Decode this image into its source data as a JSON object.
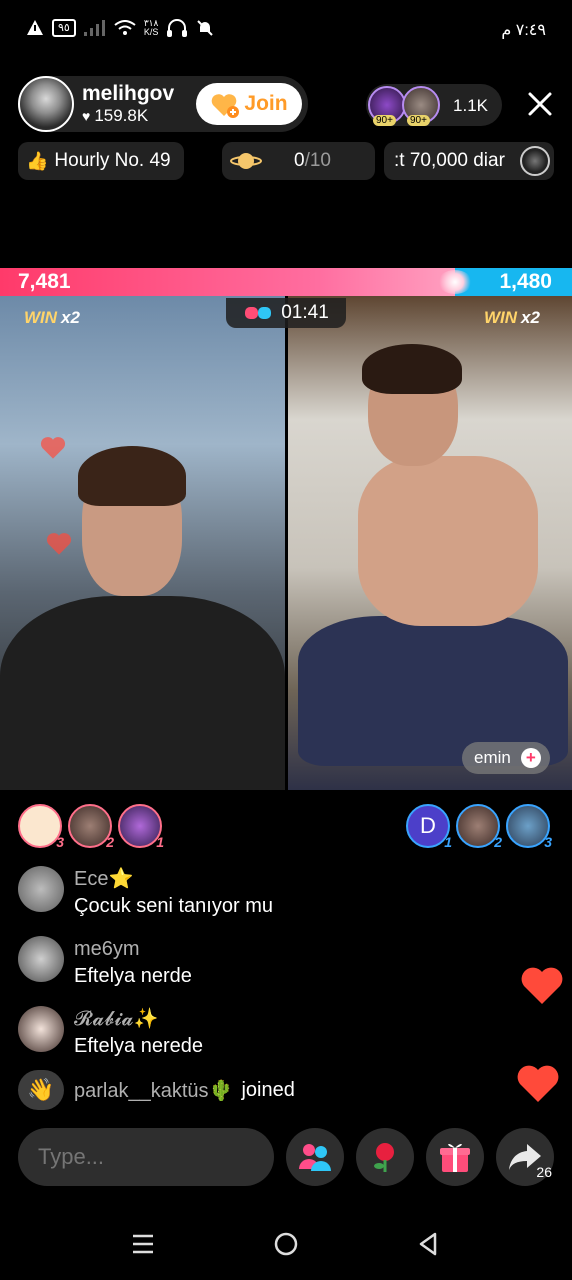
{
  "status_bar": {
    "time": "٧:٤٩ م",
    "speed": "٣١٨\nK/S",
    "battery": "٩٥"
  },
  "host": {
    "name": "melihgov",
    "likes": "159.8K",
    "join_label": "Join"
  },
  "viewers": {
    "count": "1.1K",
    "badge_1": "90+",
    "badge_2": "90+"
  },
  "chips": {
    "hourly": "Hourly No. 49",
    "planet_count": "0",
    "planet_total": "/10",
    "diamonds": ":t 70,000 diar"
  },
  "battle": {
    "left_score": "7,481",
    "right_score": "1,480",
    "timer": "01:41",
    "win_label": "WIN",
    "left_multiplier": "x2",
    "right_multiplier": "x2",
    "guest_name": "emin",
    "left_color": "#ff3a6a",
    "right_color": "#17b7f0"
  },
  "rank_left": [
    "3",
    "2",
    "1"
  ],
  "rank_right": [
    "1",
    "2",
    "3"
  ],
  "rank_right_initial": "D",
  "comments": [
    {
      "user": "Ece⭐",
      "message": "Çocuk seni tanıyor mu"
    },
    {
      "user": "me6ym",
      "message": "Eftelya nerde"
    },
    {
      "user": "𝓡𝓪𝓫𝓲𝓪✨",
      "message": "Eftelya nerede"
    }
  ],
  "join_event": {
    "user": "parlak__kaktüs🌵",
    "text": "joined"
  },
  "input": {
    "placeholder": "Type..."
  },
  "share_count": "26"
}
